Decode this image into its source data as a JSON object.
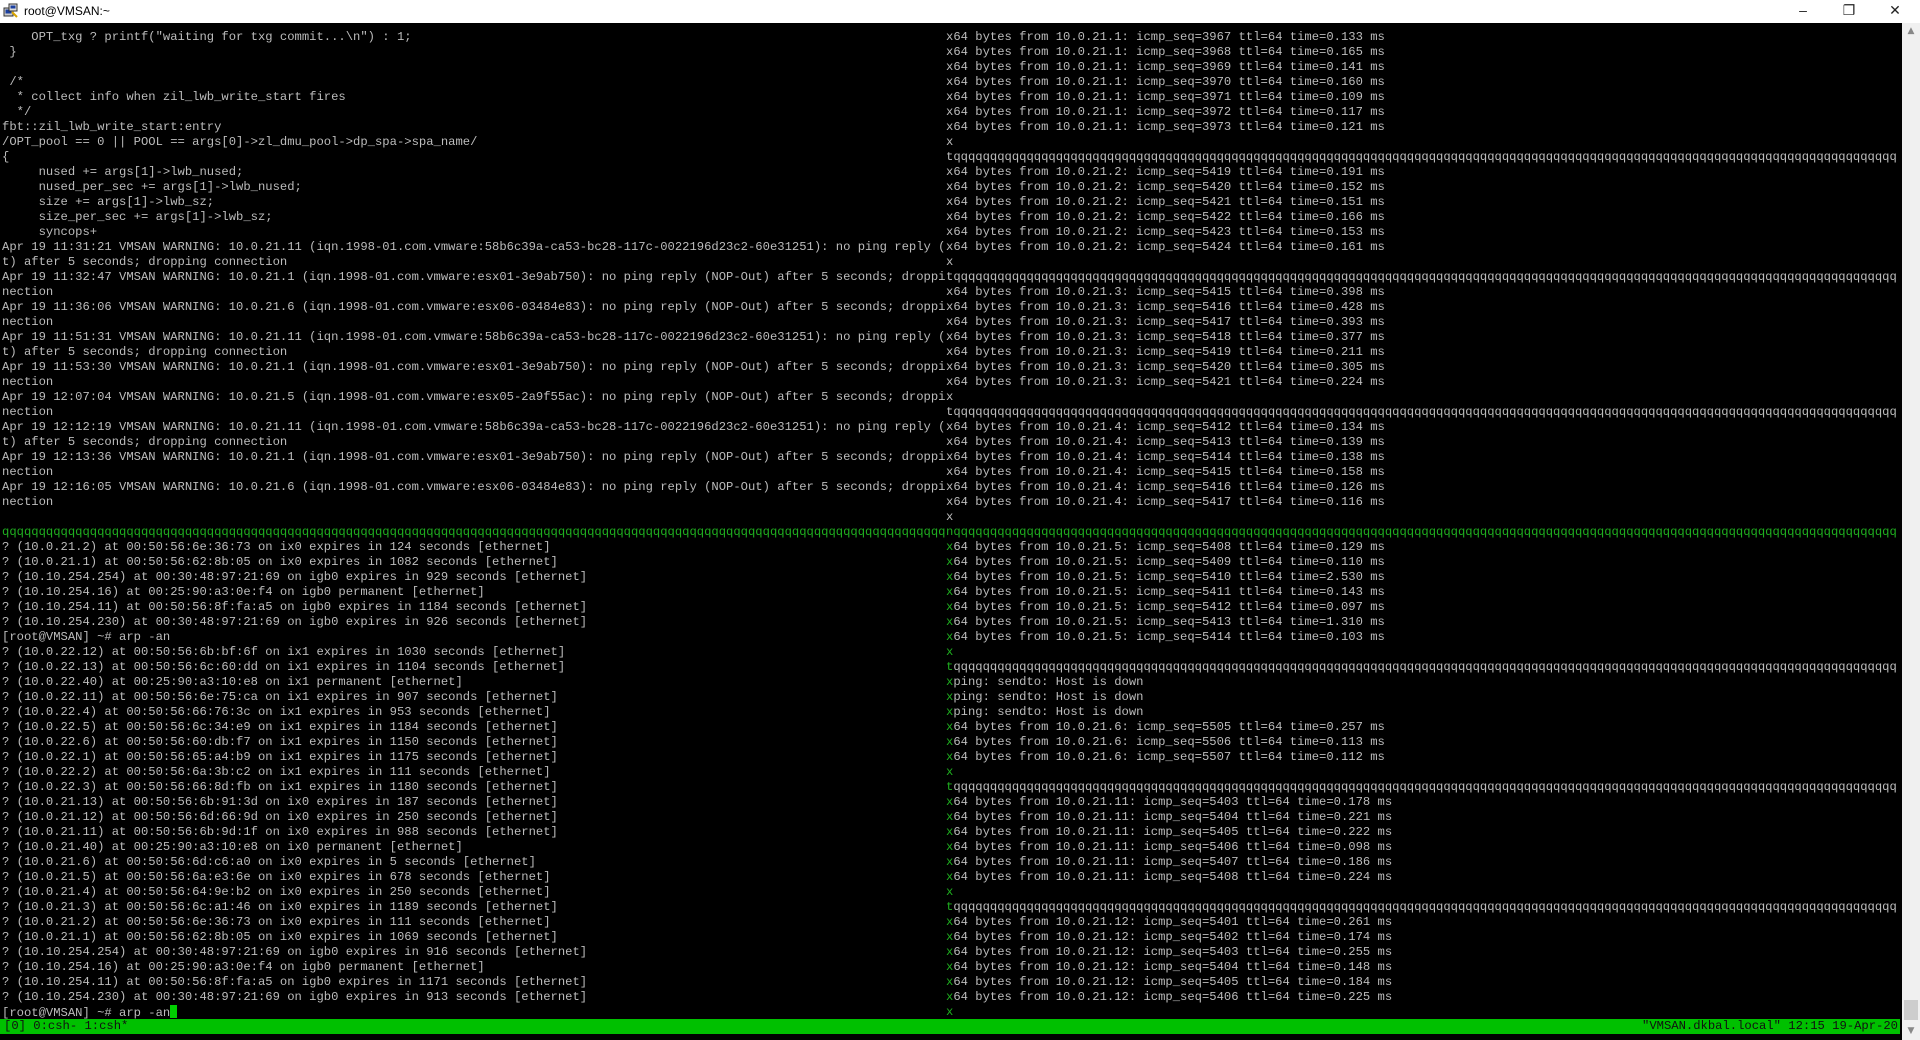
{
  "window": {
    "title": "root@VMSAN:~",
    "minimize": "–",
    "maximize": "❐",
    "close": "✕"
  },
  "left": {
    "lines": [
      "    OPT_txg ? printf(\"waiting for txg commit...\\n\") : 1;",
      " }",
      "",
      " /*",
      "  * collect info when zil_lwb_write_start fires",
      "  */",
      "fbt::zil_lwb_write_start:entry",
      "/OPT_pool == 0 || POOL == args[0]->zl_dmu_pool->dp_spa->spa_name/",
      "{",
      "     nused += args[1]->lwb_nused;",
      "     nused_per_sec += args[1]->lwb_nused;",
      "     size += args[1]->lwb_sz;",
      "     size_per_sec += args[1]->lwb_sz;",
      "     syncops+",
      "Apr 19 11:31:21 VMSAN WARNING: 10.0.21.11 (iqn.1998-01.com.vmware:58b6c39a-ca53-bc28-117c-0022196d23c2-60e31251): no ping reply (NOP-Ou",
      "t) after 5 seconds; dropping connection",
      "Apr 19 11:32:47 VMSAN WARNING: 10.0.21.1 (iqn.1998-01.com.vmware:esx01-3e9ab750): no ping reply (NOP-Out) after 5 seconds; dropping con",
      "nection",
      "Apr 19 11:36:06 VMSAN WARNING: 10.0.21.6 (iqn.1998-01.com.vmware:esx06-03484e83): no ping reply (NOP-Out) after 5 seconds; dropping con",
      "nection",
      "Apr 19 11:51:31 VMSAN WARNING: 10.0.21.11 (iqn.1998-01.com.vmware:58b6c39a-ca53-bc28-117c-0022196d23c2-60e31251): no ping reply (NOP-Ou",
      "t) after 5 seconds; dropping connection",
      "Apr 19 11:53:30 VMSAN WARNING: 10.0.21.1 (iqn.1998-01.com.vmware:esx01-3e9ab750): no ping reply (NOP-Out) after 5 seconds; dropping con",
      "nection",
      "Apr 19 12:07:04 VMSAN WARNING: 10.0.21.5 (iqn.1998-01.com.vmware:esx05-2a9f55ac): no ping reply (NOP-Out) after 5 seconds; dropping con",
      "nection",
      "Apr 19 12:12:19 VMSAN WARNING: 10.0.21.11 (iqn.1998-01.com.vmware:58b6c39a-ca53-bc28-117c-0022196d23c2-60e31251): no ping reply (NOP-Ou",
      "t) after 5 seconds; dropping connection",
      "Apr 19 12:13:36 VMSAN WARNING: 10.0.21.1 (iqn.1998-01.com.vmware:esx01-3e9ab750): no ping reply (NOP-Out) after 5 seconds; dropping con",
      "nection",
      "Apr 19 12:16:05 VMSAN WARNING: 10.0.21.6 (iqn.1998-01.com.vmware:esx06-03484e83): no ping reply (NOP-Out) after 5 seconds; dropping con",
      "nection",
      "",
      "qqqqqqqqqqqqqqqqqqqqqqqqqqqqqqqqqqqqqqqqqqqqqqqqqqqqqqqqqqqqqqqqqqqqqqqqqqqqqqqqqqqqqqqqqqqqqqqqqqqqqqqqqqqqqqqqqqqqqqqqqqqqqqqqq",
      "? (10.0.21.2) at 00:50:56:6e:36:73 on ix0 expires in 124 seconds [ethernet]",
      "? (10.0.21.1) at 00:50:56:62:8b:05 on ix0 expires in 1082 seconds [ethernet]",
      "? (10.10.254.254) at 00:30:48:97:21:69 on igb0 expires in 929 seconds [ethernet]",
      "? (10.10.254.16) at 00:25:90:a3:0e:f4 on igb0 permanent [ethernet]",
      "? (10.10.254.11) at 00:50:56:8f:fa:a5 on igb0 expires in 1184 seconds [ethernet]",
      "? (10.10.254.230) at 00:30:48:97:21:69 on igb0 expires in 926 seconds [ethernet]",
      "[root@VMSAN] ~# arp -an",
      "? (10.0.22.12) at 00:50:56:6b:bf:6f on ix1 expires in 1030 seconds [ethernet]",
      "? (10.0.22.13) at 00:50:56:6c:60:dd on ix1 expires in 1104 seconds [ethernet]",
      "? (10.0.22.40) at 00:25:90:a3:10:e8 on ix1 permanent [ethernet]",
      "? (10.0.22.11) at 00:50:56:6e:75:ca on ix1 expires in 907 seconds [ethernet]",
      "? (10.0.22.4) at 00:50:56:66:76:3c on ix1 expires in 953 seconds [ethernet]",
      "? (10.0.22.5) at 00:50:56:6c:34:e9 on ix1 expires in 1184 seconds [ethernet]",
      "? (10.0.22.6) at 00:50:56:60:db:f7 on ix1 expires in 1150 seconds [ethernet]",
      "? (10.0.22.1) at 00:50:56:65:a4:b9 on ix1 expires in 1175 seconds [ethernet]",
      "? (10.0.22.2) at 00:50:56:6a:3b:c2 on ix1 expires in 111 seconds [ethernet]",
      "? (10.0.22.3) at 00:50:56:66:8d:fb on ix1 expires in 1180 seconds [ethernet]",
      "? (10.0.21.13) at 00:50:56:6b:91:3d on ix0 expires in 187 seconds [ethernet]",
      "? (10.0.21.12) at 00:50:56:6d:66:9d on ix0 expires in 250 seconds [ethernet]",
      "? (10.0.21.11) at 00:50:56:6b:9d:1f on ix0 expires in 988 seconds [ethernet]",
      "? (10.0.21.40) at 00:25:90:a3:10:e8 on ix0 permanent [ethernet]",
      "? (10.0.21.6) at 00:50:56:6d:c6:a0 on ix0 expires in 5 seconds [ethernet]",
      "? (10.0.21.5) at 00:50:56:6a:e3:6e on ix0 expires in 678 seconds [ethernet]",
      "? (10.0.21.4) at 00:50:56:64:9e:b2 on ix0 expires in 250 seconds [ethernet]",
      "? (10.0.21.3) at 00:50:56:6c:a1:46 on ix0 expires in 1189 seconds [ethernet]",
      "? (10.0.21.2) at 00:50:56:6e:36:73 on ix0 expires in 111 seconds [ethernet]",
      "? (10.0.21.1) at 00:50:56:62:8b:05 on ix0 expires in 1069 seconds [ethernet]",
      "? (10.10.254.254) at 00:30:48:97:21:69 on igb0 expires in 916 seconds [ethernet]",
      "? (10.10.254.16) at 00:25:90:a3:0e:f4 on igb0 permanent [ethernet]",
      "? (10.10.254.11) at 00:50:56:8f:fa:a5 on igb0 expires in 1171 seconds [ethernet]",
      "? (10.10.254.230) at 00:30:48:97:21:69 on igb0 expires in 913 seconds [ethernet]",
      "[root@VMSAN] ~# arp -an"
    ]
  },
  "right": {
    "lines": [
      {
        "b": "x",
        "t": "64 bytes from 10.0.21.1: icmp_seq=3967 ttl=64 time=0.133 ms"
      },
      {
        "b": "x",
        "t": "64 bytes from 10.0.21.1: icmp_seq=3968 ttl=64 time=0.165 ms"
      },
      {
        "b": "x",
        "t": "64 bytes from 10.0.21.1: icmp_seq=3969 ttl=64 time=0.141 ms"
      },
      {
        "b": "x",
        "t": "64 bytes from 10.0.21.1: icmp_seq=3970 ttl=64 time=0.160 ms"
      },
      {
        "b": "x",
        "t": "64 bytes from 10.0.21.1: icmp_seq=3971 ttl=64 time=0.109 ms"
      },
      {
        "b": "x",
        "t": "64 bytes from 10.0.21.1: icmp_seq=3972 ttl=64 time=0.117 ms"
      },
      {
        "b": "x",
        "t": "64 bytes from 10.0.21.1: icmp_seq=3973 ttl=64 time=0.121 ms"
      },
      {
        "b": "x",
        "t": ""
      },
      {
        "b": "t",
        "t": "qqqqqqqqqqqqqqqqqqqqqqqqqqqqqqqqqqqqqqqqqqqqqqqqqqqqqqqqqqqqqqqqqqqqqqqqqqqqqqqqqqqqqqqqqqqqqqqqqqqqqqqqqqqqqqqqqqqqqqqqqqqqqqqqq"
      },
      {
        "b": "x",
        "t": "64 bytes from 10.0.21.2: icmp_seq=5419 ttl=64 time=0.191 ms"
      },
      {
        "b": "x",
        "t": "64 bytes from 10.0.21.2: icmp_seq=5420 ttl=64 time=0.152 ms"
      },
      {
        "b": "x",
        "t": "64 bytes from 10.0.21.2: icmp_seq=5421 ttl=64 time=0.151 ms"
      },
      {
        "b": "x",
        "t": "64 bytes from 10.0.21.2: icmp_seq=5422 ttl=64 time=0.166 ms"
      },
      {
        "b": "x",
        "t": "64 bytes from 10.0.21.2: icmp_seq=5423 ttl=64 time=0.153 ms"
      },
      {
        "b": "x",
        "t": "64 bytes from 10.0.21.2: icmp_seq=5424 ttl=64 time=0.161 ms"
      },
      {
        "b": "x",
        "t": ""
      },
      {
        "b": "t",
        "t": "qqqqqqqqqqqqqqqqqqqqqqqqqqqqqqqqqqqqqqqqqqqqqqqqqqqqqqqqqqqqqqqqqqqqqqqqqqqqqqqqqqqqqqqqqqqqqqqqqqqqqqqqqqqqqqqqqqqqqqqqqqqqqqqqq"
      },
      {
        "b": "x",
        "t": "64 bytes from 10.0.21.3: icmp_seq=5415 ttl=64 time=0.398 ms"
      },
      {
        "b": "x",
        "t": "64 bytes from 10.0.21.3: icmp_seq=5416 ttl=64 time=0.428 ms"
      },
      {
        "b": "x",
        "t": "64 bytes from 10.0.21.3: icmp_seq=5417 ttl=64 time=0.393 ms"
      },
      {
        "b": "x",
        "t": "64 bytes from 10.0.21.3: icmp_seq=5418 ttl=64 time=0.377 ms"
      },
      {
        "b": "x",
        "t": "64 bytes from 10.0.21.3: icmp_seq=5419 ttl=64 time=0.211 ms"
      },
      {
        "b": "x",
        "t": "64 bytes from 10.0.21.3: icmp_seq=5420 ttl=64 time=0.305 ms"
      },
      {
        "b": "x",
        "t": "64 bytes from 10.0.21.3: icmp_seq=5421 ttl=64 time=0.224 ms"
      },
      {
        "b": "x",
        "t": ""
      },
      {
        "b": "t",
        "t": "qqqqqqqqqqqqqqqqqqqqqqqqqqqqqqqqqqqqqqqqqqqqqqqqqqqqqqqqqqqqqqqqqqqqqqqqqqqqqqqqqqqqqqqqqqqqqqqqqqqqqqqqqqqqqqqqqqqqqqqqqqqqqqqqq"
      },
      {
        "b": "x",
        "t": "64 bytes from 10.0.21.4: icmp_seq=5412 ttl=64 time=0.134 ms"
      },
      {
        "b": "x",
        "t": "64 bytes from 10.0.21.4: icmp_seq=5413 ttl=64 time=0.139 ms"
      },
      {
        "b": "x",
        "t": "64 bytes from 10.0.21.4: icmp_seq=5414 ttl=64 time=0.138 ms"
      },
      {
        "b": "x",
        "t": "64 bytes from 10.0.21.4: icmp_seq=5415 ttl=64 time=0.158 ms"
      },
      {
        "b": "x",
        "t": "64 bytes from 10.0.21.4: icmp_seq=5416 ttl=64 time=0.126 ms"
      },
      {
        "b": "x",
        "t": "64 bytes from 10.0.21.4: icmp_seq=5417 ttl=64 time=0.116 ms"
      },
      {
        "b": "x",
        "t": ""
      },
      {
        "b": "n",
        "t": "qqqqqqqqqqqqqqqqqqqqqqqqqqqqqqqqqqqqqqqqqqqqqqqqqqqqqqqqqqqqqqqqqqqqqqqqqqqqqqqqqqqqqqqqqqqqqqqqqqqqqqqqqqqqqqqqqqqqqqqqqqqqqqqqq"
      },
      {
        "b": "x",
        "t": "64 bytes from 10.0.21.5: icmp_seq=5408 ttl=64 time=0.129 ms"
      },
      {
        "b": "x",
        "t": "64 bytes from 10.0.21.5: icmp_seq=5409 ttl=64 time=0.110 ms"
      },
      {
        "b": "x",
        "t": "64 bytes from 10.0.21.5: icmp_seq=5410 ttl=64 time=2.530 ms"
      },
      {
        "b": "x",
        "t": "64 bytes from 10.0.21.5: icmp_seq=5411 ttl=64 time=0.143 ms"
      },
      {
        "b": "x",
        "t": "64 bytes from 10.0.21.5: icmp_seq=5412 ttl=64 time=0.097 ms"
      },
      {
        "b": "x",
        "t": "64 bytes from 10.0.21.5: icmp_seq=5413 ttl=64 time=1.310 ms"
      },
      {
        "b": "x",
        "t": "64 bytes from 10.0.21.5: icmp_seq=5414 ttl=64 time=0.103 ms"
      },
      {
        "b": "x",
        "t": ""
      },
      {
        "b": "t",
        "t": "qqqqqqqqqqqqqqqqqqqqqqqqqqqqqqqqqqqqqqqqqqqqqqqqqqqqqqqqqqqqqqqqqqqqqqqqqqqqqqqqqqqqqqqqqqqqqqqqqqqqqqqqqqqqqqqqqqqqqqqqqqqqqqqqq"
      },
      {
        "b": "x",
        "t": "ping: sendto: Host is down"
      },
      {
        "b": "x",
        "t": "ping: sendto: Host is down"
      },
      {
        "b": "x",
        "t": "ping: sendto: Host is down"
      },
      {
        "b": "x",
        "t": "64 bytes from 10.0.21.6: icmp_seq=5505 ttl=64 time=0.257 ms"
      },
      {
        "b": "x",
        "t": "64 bytes from 10.0.21.6: icmp_seq=5506 ttl=64 time=0.113 ms"
      },
      {
        "b": "x",
        "t": "64 bytes from 10.0.21.6: icmp_seq=5507 ttl=64 time=0.112 ms"
      },
      {
        "b": "x",
        "t": ""
      },
      {
        "b": "t",
        "t": "qqqqqqqqqqqqqqqqqqqqqqqqqqqqqqqqqqqqqqqqqqqqqqqqqqqqqqqqqqqqqqqqqqqqqqqqqqqqqqqqqqqqqqqqqqqqqqqqqqqqqqqqqqqqqqqqqqqqqqqqqqqqqqqqq"
      },
      {
        "b": "x",
        "t": "64 bytes from 10.0.21.11: icmp_seq=5403 ttl=64 time=0.178 ms"
      },
      {
        "b": "x",
        "t": "64 bytes from 10.0.21.11: icmp_seq=5404 ttl=64 time=0.221 ms"
      },
      {
        "b": "x",
        "t": "64 bytes from 10.0.21.11: icmp_seq=5405 ttl=64 time=0.222 ms"
      },
      {
        "b": "x",
        "t": "64 bytes from 10.0.21.11: icmp_seq=5406 ttl=64 time=0.098 ms"
      },
      {
        "b": "x",
        "t": "64 bytes from 10.0.21.11: icmp_seq=5407 ttl=64 time=0.186 ms"
      },
      {
        "b": "x",
        "t": "64 bytes from 10.0.21.11: icmp_seq=5408 ttl=64 time=0.224 ms"
      },
      {
        "b": "x",
        "t": ""
      },
      {
        "b": "t",
        "t": "qqqqqqqqqqqqqqqqqqqqqqqqqqqqqqqqqqqqqqqqqqqqqqqqqqqqqqqqqqqqqqqqqqqqqqqqqqqqqqqqqqqqqqqqqqqqqqqqqqqqqqqqqqqqqqqqqqqqqqqqqqqqqqqqq"
      },
      {
        "b": "x",
        "t": "64 bytes from 10.0.21.12: icmp_seq=5401 ttl=64 time=0.261 ms"
      },
      {
        "b": "x",
        "t": "64 bytes from 10.0.21.12: icmp_seq=5402 ttl=64 time=0.174 ms"
      },
      {
        "b": "x",
        "t": "64 bytes from 10.0.21.12: icmp_seq=5403 ttl=64 time=0.255 ms"
      },
      {
        "b": "x",
        "t": "64 bytes from 10.0.21.12: icmp_seq=5404 ttl=64 time=0.148 ms"
      },
      {
        "b": "x",
        "t": "64 bytes from 10.0.21.12: icmp_seq=5405 ttl=64 time=0.184 ms"
      },
      {
        "b": "x",
        "t": "64 bytes from 10.0.21.12: icmp_seq=5406 ttl=64 time=0.225 ms"
      },
      {
        "b": "x",
        "t": ""
      }
    ]
  },
  "status": {
    "windows": "[0] 0:csh- 1:csh*",
    "right": "\"VMSAN.dkbal.local\" 12:15 19-Apr-20"
  },
  "colors": {
    "text": "#bcbcbc",
    "active_border": "#1fae1f",
    "status_bar": "#00c000"
  }
}
